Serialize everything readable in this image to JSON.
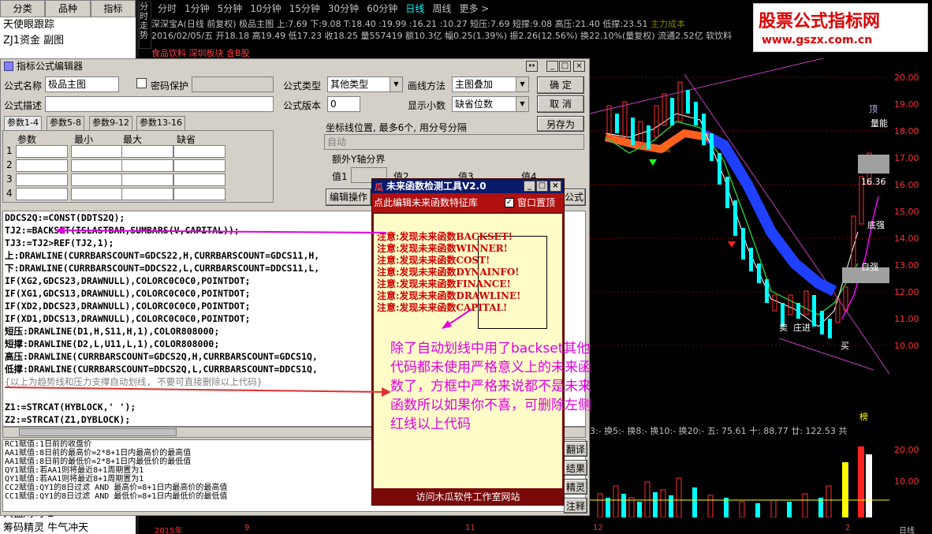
{
  "left_panel": {
    "tabs": [
      "分类",
      "品种",
      "指标"
    ],
    "items": [
      "天使眼跟踪",
      "ZJ1资金 副图"
    ],
    "bottom_items": [
      "大盘/示了2",
      "筹码精灵 牛气冲天"
    ]
  },
  "vertical_label": "分时走势",
  "periods": [
    "分时",
    "1分钟",
    "5分钟",
    "10分钟",
    "15分钟",
    "30分钟",
    "60分钟",
    "日线",
    "周线",
    "更多 >"
  ],
  "active_period": "日线",
  "stock": {
    "line1": "深深宝A(日线 前复权) 极品主图  上:7.69  下:9.08  T:18.40 :19.99 :16.21 :10.27  短压:7.69  短撑:9.08  高压:21.40  低撑:23.51",
    "line1_right": "主力成本",
    "line2": "2016/02/05/五  开18.18 高19.49 低17.23 收18.25 量557419 额10.3亿 幅0.25(1.39%) 振2.26(12.56%) 换22.10%(量复权) 流通2.52亿 软饮料",
    "line3": "食品饮料  深圳板块  含B股"
  },
  "watermark": {
    "title": "股票公式指标网",
    "url": "www.gszx.com.cn"
  },
  "y_axis": {
    "ticks": [
      "20.00",
      "19.00",
      "18.00",
      "17.00",
      "16.00",
      "15.00",
      "14.00",
      "13.00",
      "12.00",
      "11.00",
      "10.00"
    ],
    "vol_ticks": [
      "20.00",
      "10.00"
    ]
  },
  "chart_labels": {
    "buy": "买",
    "sell": "卖",
    "zhuangjin": "庄进",
    "price": "16.36",
    "top": "顶",
    "labels": [
      "量能",
      "底强",
      "自强",
      "底强",
      "榜"
    ]
  },
  "bottom_indicator": "3:-  换5:-  换8:-  换10:-  换20:-  五: 75.61  十: 88.77  廿: 122.53  共",
  "time_axis": [
    "2015年",
    "9",
    "11",
    "12",
    "2",
    "日线"
  ],
  "dialog": {
    "title": "指标公式编辑器",
    "formula_name_label": "公式名称",
    "formula_name_value": "极品主图",
    "password_label": "密码保护",
    "formula_type_label": "公式类型",
    "formula_type_value": "其他类型",
    "draw_method_label": "画线方法",
    "draw_method_value": "主图叠加",
    "ok_label": "确  定",
    "cancel_label": "取  消",
    "saveas_label": "另存为",
    "desc_label": "公式描述",
    "version_label": "公式版本",
    "version_value": "0",
    "decimals_label": "显示小数",
    "decimals_value": "缺省位数",
    "tabs": [
      "参数1-4",
      "参数5-8",
      "参数9-12",
      "参数13-16"
    ],
    "param_headers": [
      "参数",
      "最小",
      "最大",
      "缺省"
    ],
    "param_rows": [
      "1",
      "2",
      "3",
      "4"
    ],
    "coord_label": "坐标线位置, 最多6个, 用分号分隔",
    "coord_value": "自动",
    "extra_y_label": "额外Y轴分界",
    "val_labels": [
      "值1",
      "值2",
      "值3",
      "值4"
    ],
    "edit_ops_label": "编辑操作",
    "formula_btn_label": "公式",
    "code": [
      "DDCS2Q:=CONST(DDTS2Q);",
      "TJ2:=BACKSET(ISLASTBAR,SUMBARS(V,CAPITAL));",
      "TJ3:=TJ2>REF(TJ2,1);",
      "上:DRAWLINE(CURRBARSCOUNT=GDCS22,H,CURRBARSCOUNT=GDCS11,H,",
      "下:DRAWLINE(CURRBARSCOUNT=DDCS22,L,CURRBARSCOUNT=DDCS11,L,",
      "IF(XG2,GDCS23,DRAWNULL),COLORC0C0C0,POINTDOT;",
      "IF(XG1,GDCS13,DRAWNULL),COLORC0C0C0,POINTDOT;",
      "IF(XD2,DDCS23,DRAWNULL),COLORC0C0C0,POINTDOT;",
      "IF(XD1,DDCS13,DRAWNULL),COLORC0C0C0,POINTDOT;",
      "短压:DRAWLINE(D1,H,S11,H,1),COLOR808000;",
      "短撑:DRAWLINE(D2,L,U11,L,1),COLOR808000;",
      "高压:DRAWLINE(CURRBARSCOUNT=GDCS2Q,H,CURRBARSCOUNT=GDCS1Q,",
      "低撑:DRAWLINE(CURRBARSCOUNT=DDCS2Q,L,CURRBARSCOUNT=DDCS1Q,",
      "{以上为趋势线和压力支撑自动划线, 不要可直接删除以上代码}",
      "",
      "Z1:=STRCAT(HYBLOCK,' ');",
      " Z2:=STRCAT(Z1,DYBLOCK);"
    ],
    "descriptions": [
      "RC1赋值:1日前的收盘价",
      "AA1赋值:8日前的最高价=2*8+1日内最高价的最高值",
      "AA1赋值:8日前的最低价=2*8+1日内最低价的最低值",
      "QY1赋值:若AA1则将最近8+1周期置为1",
      "QY1赋值:若AA1则将最近8+1周期置为1",
      "CC2赋值:QY1的8日过滤 AND 最高价=8+1日内最高价的最高值",
      "CC1赋值:QY1的8日过滤 AND 最低价=8+1日内最低价的最低值"
    ],
    "side_btns": [
      "翻译",
      "结果",
      "精灵",
      "注释"
    ]
  },
  "popup": {
    "title": "未来函数检测工具V2.0",
    "link": "点此编辑未来函数特征库",
    "top_label": "窗口置顶",
    "warnings": [
      "注意:发现未来函数BACKSET!",
      "注意:发现未来函数WINNER!",
      "注意:发现未来函数COST!",
      "注意:发现未来函数DYNAINFO!",
      "注意:发现未来函数FINANCE!",
      "注意:发现未来函数DRAWLINE!",
      "注意:发现未来函数CAPITAL!"
    ],
    "note": "除了自动划线中用了backset其他代码都未使用严格意义上的未来函数了，方框中严格来说都不是未来函数所以如果你不喜，可删除左侧红线以上代码",
    "footer": "访问木瓜软件工作室网站"
  },
  "colors": {
    "accent": "#ff00ff",
    "up": "#ff3030",
    "down": "#00ffff",
    "popup_bg": "#7a0a0a"
  }
}
